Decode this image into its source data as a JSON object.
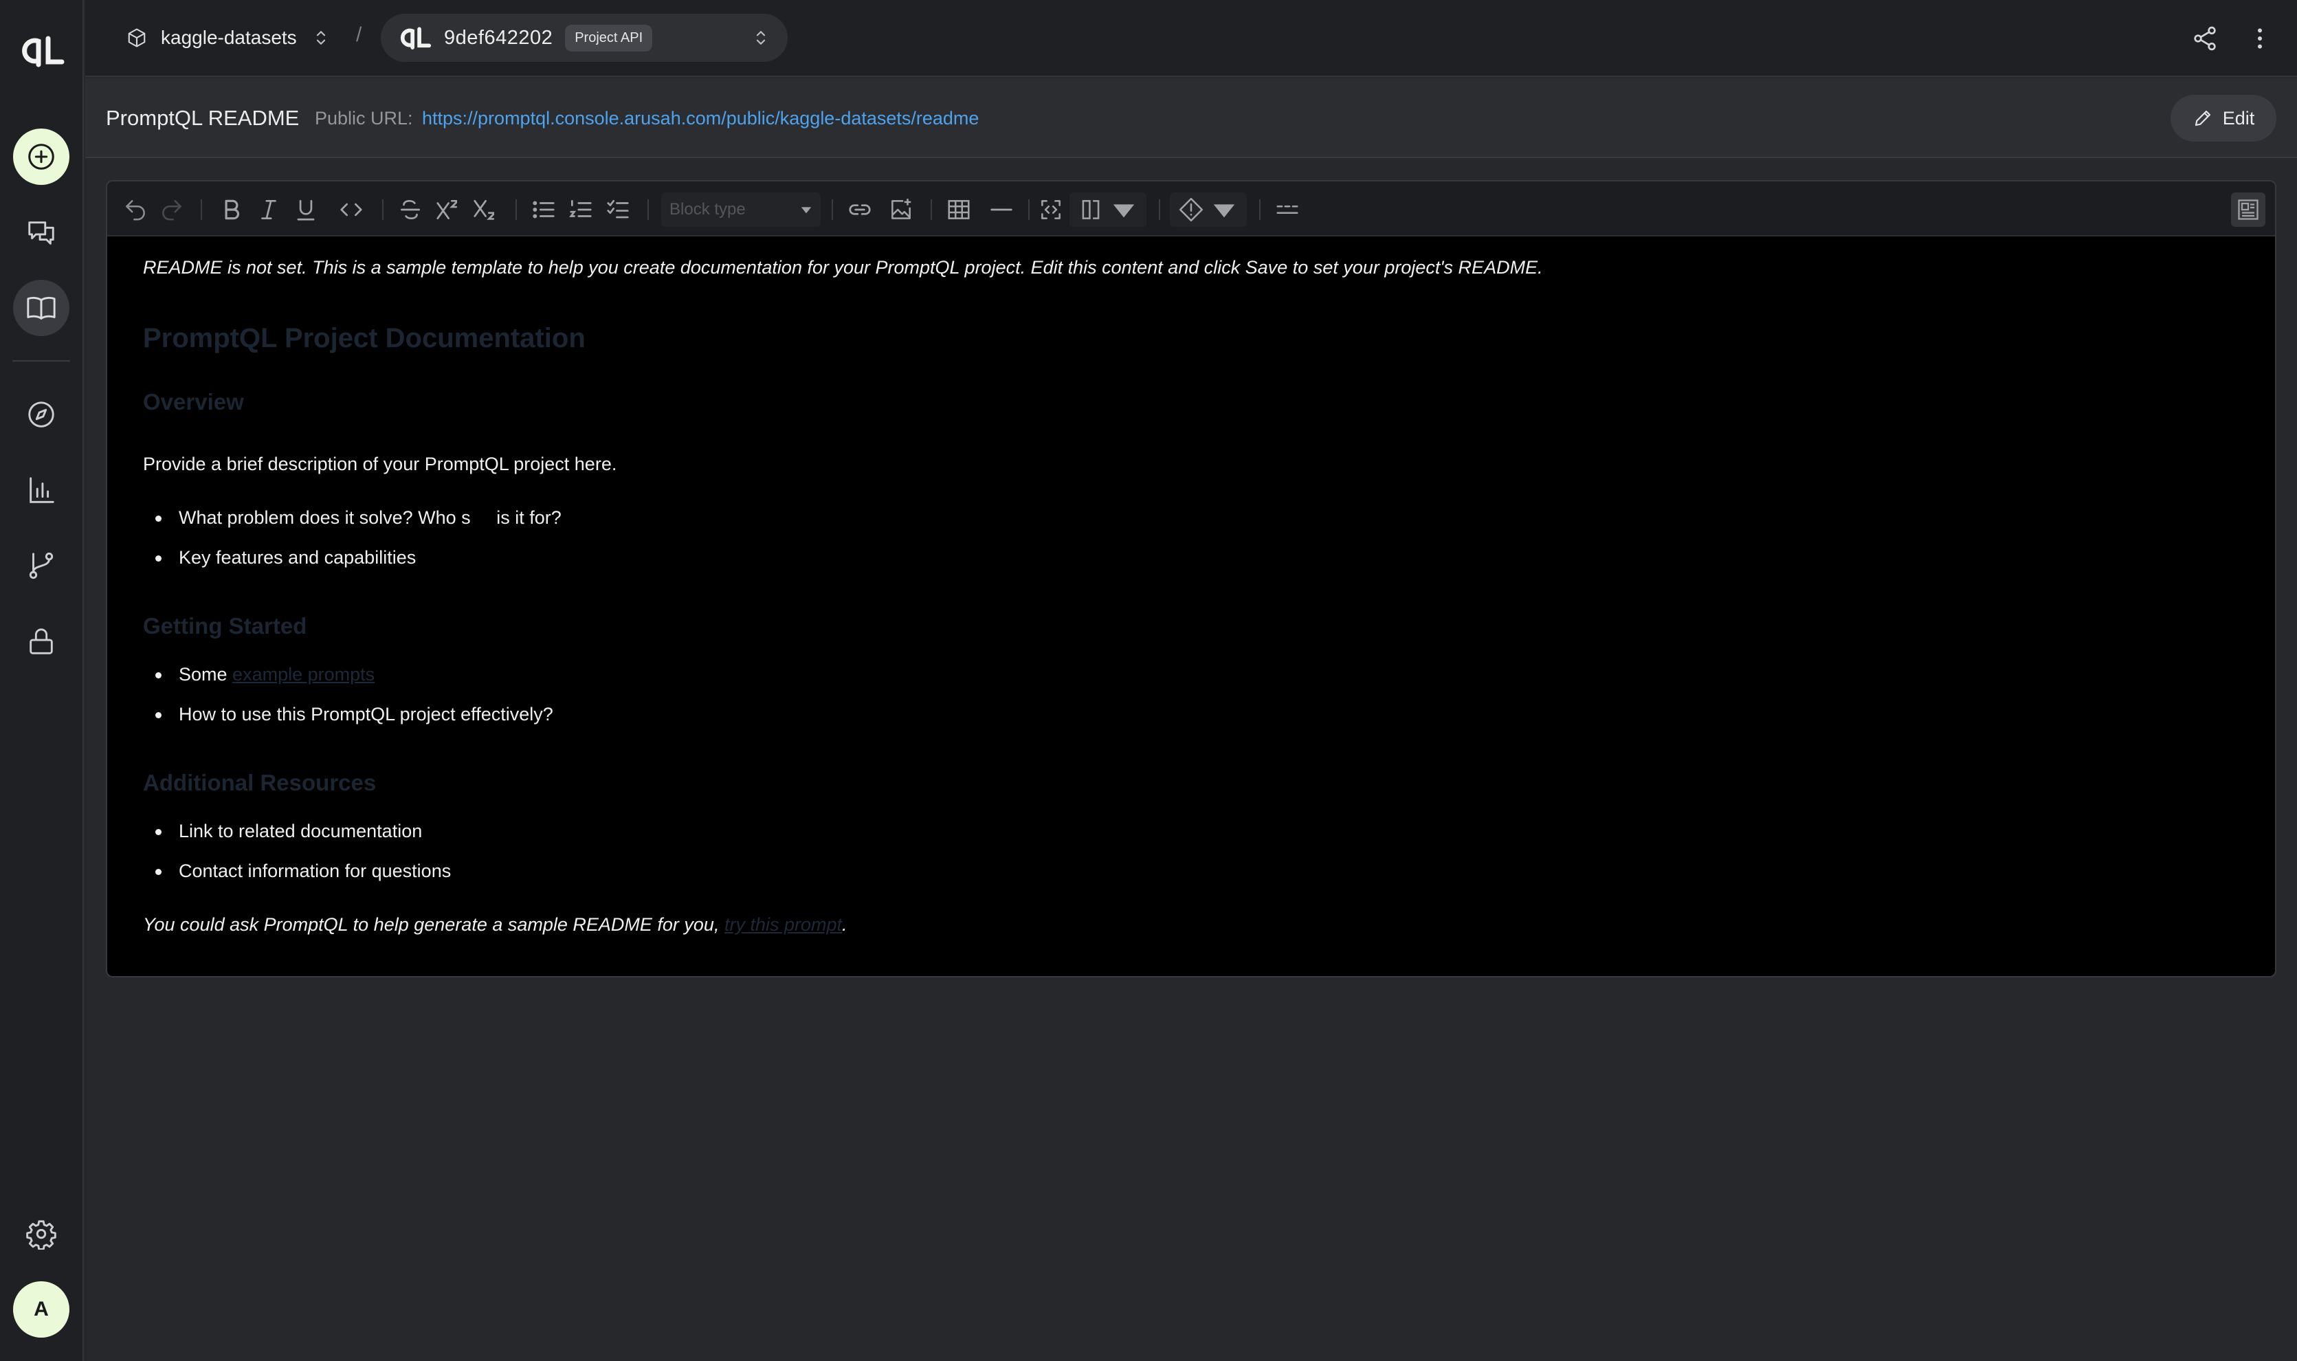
{
  "topbar": {
    "project_name": "kaggle-datasets",
    "separator": "/",
    "build_id": "9def642202",
    "build_badge": "Project API"
  },
  "titlebar": {
    "title": "PromptQL README",
    "public_url_label": "Public URL:",
    "public_url": "https://promptql.console.arusah.com/public/kaggle-datasets/readme",
    "edit_label": "Edit"
  },
  "toolbar": {
    "block_type_placeholder": "Block type"
  },
  "readme": {
    "intro": "README is not set. This is a sample template to help you create documentation for your PromptQL project. Edit this content and click Save to set your project's README.",
    "h1": "PromptQL Project Documentation",
    "overview_heading": "Overview",
    "overview_text": "Provide a brief description of your PromptQL project here.",
    "overview_items": [
      "What problem does it solve? Who s     is it for?",
      "Key features and capabilities"
    ],
    "getting_started_heading": "Getting Started",
    "gs_item1_prefix": "Some ",
    "gs_item1_link": "example prompts",
    "gs_item2": "How to use this PromptQL project effectively?",
    "resources_heading": "Additional Resources",
    "resources_items": [
      "Link to related documentation",
      "Contact information for questions"
    ],
    "footer_prefix": "You could ask PromptQL to help generate a sample README for you, ",
    "footer_link": "try this prompt",
    "footer_suffix": "."
  },
  "user": {
    "avatar_initial": "A"
  },
  "icons": {
    "rail": [
      "promptql-logo",
      "plus-circle-icon",
      "chat-icon",
      "book-icon",
      "compass-icon",
      "bar-chart-icon",
      "git-branch-icon",
      "lock-icon",
      "gear-icon"
    ],
    "topbar": [
      "cube-icon",
      "chevron-updown-icon",
      "share-icon",
      "more-vertical-icon"
    ]
  },
  "colors": {
    "accent_green": "#eaf9d8",
    "link_blue": "#4ea3ef",
    "background": "#27282c",
    "editor_bg": "#000000"
  }
}
